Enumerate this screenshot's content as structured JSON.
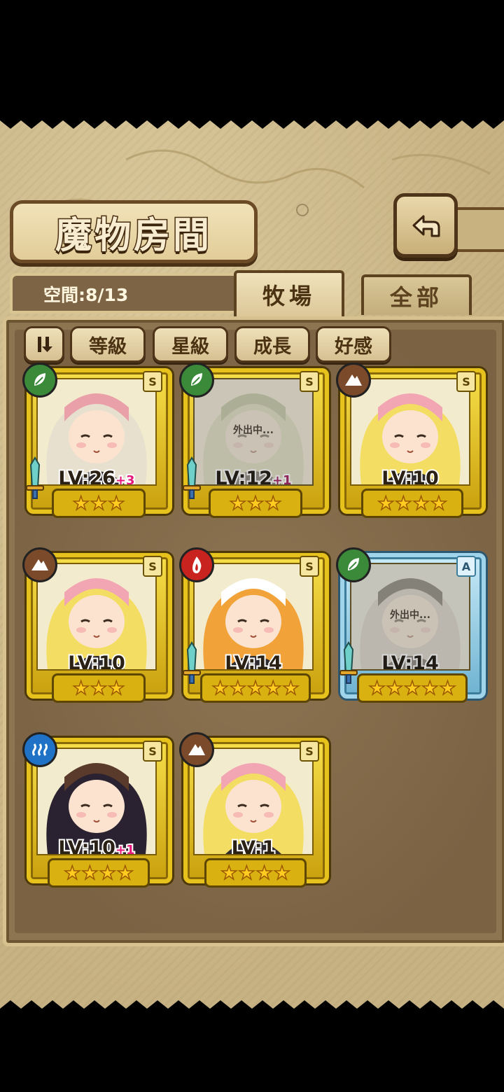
{
  "screen": {
    "title": "魔物房間",
    "capacity": "空間:8/13",
    "tabs": [
      {
        "label": "牧場",
        "active": true
      },
      {
        "label": "全部",
        "active": false
      }
    ],
    "filters": [
      "等級",
      "星級",
      "成長",
      "好感"
    ],
    "away_label": "外出中..."
  },
  "monsters": [
    {
      "lv": "LV:26",
      "bonus": "+3",
      "stars": 3,
      "rank": "S",
      "element": "leaf-icon",
      "element_color": "#3b8a3a",
      "frame": "gold",
      "weapon": true,
      "away": false,
      "char": "bunny"
    },
    {
      "lv": "LV:12",
      "bonus": "+1",
      "stars": 3,
      "rank": "S",
      "element": "leaf-icon",
      "element_color": "#3b8a3a",
      "frame": "gold",
      "weapon": true,
      "away": true,
      "char": "lotus"
    },
    {
      "lv": "LV:10",
      "bonus": "",
      "stars": 4,
      "rank": "S",
      "element": "earth-icon",
      "element_color": "#7a4a2a",
      "frame": "gold",
      "weapon": false,
      "away": false,
      "char": "blonde"
    },
    {
      "lv": "LV:10",
      "bonus": "",
      "stars": 3,
      "rank": "S",
      "element": "earth-icon",
      "element_color": "#7a4a2a",
      "frame": "gold",
      "weapon": false,
      "away": false,
      "char": "blonde"
    },
    {
      "lv": "LV:14",
      "bonus": "",
      "stars": 5,
      "rank": "S",
      "element": "fire-icon",
      "element_color": "#c8231e",
      "frame": "gold",
      "weapon": true,
      "away": false,
      "char": "maid"
    },
    {
      "lv": "LV:14",
      "bonus": "",
      "stars": 5,
      "rank": "A",
      "element": "leaf-icon",
      "element_color": "#3b8a3a",
      "frame": "blue",
      "weapon": true,
      "away": true,
      "char": "silver"
    },
    {
      "lv": "LV:10",
      "bonus": "+1",
      "stars": 4,
      "rank": "S",
      "element": "water-icon",
      "element_color": "#1f72c6",
      "frame": "gold",
      "weapon": false,
      "away": false,
      "char": "elma"
    },
    {
      "lv": "LV:1",
      "bonus": "",
      "stars": 4,
      "rank": "S",
      "element": "earth-icon",
      "element_color": "#7a4a2a",
      "frame": "gold",
      "weapon": false,
      "away": false,
      "char": "blonde"
    }
  ]
}
